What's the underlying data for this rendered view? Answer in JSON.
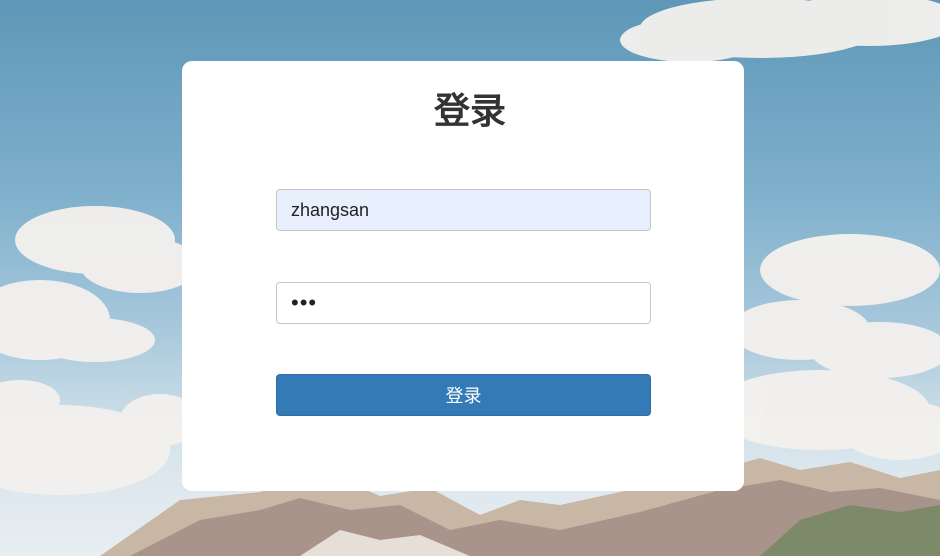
{
  "login": {
    "title": "登录",
    "username_value": "zhangsan",
    "password_value": "123",
    "submit_label": "登录"
  },
  "theme": {
    "button_color": "#337ab7",
    "autofill_bg": "#e8f0fe",
    "card_bg": "#ffffff"
  }
}
